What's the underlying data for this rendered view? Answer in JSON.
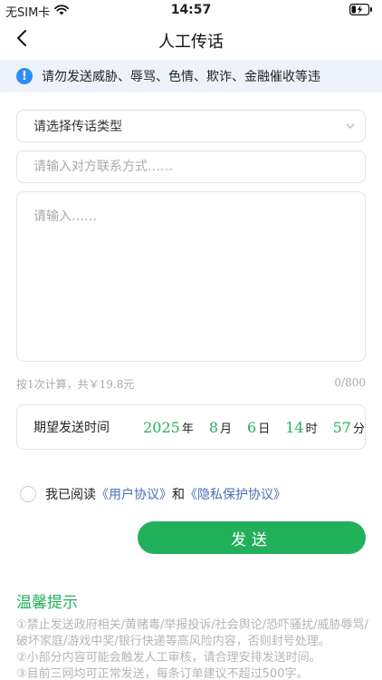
{
  "status_bar": {
    "carrier": "无SIM卡",
    "time": "14:57"
  },
  "nav": {
    "title": "人工传话"
  },
  "notice": {
    "text": "请勿发送威胁、辱骂、色情、欺诈、金融催收等违"
  },
  "form": {
    "type_select_label": "请选择传话类型",
    "contact_placeholder": "请输入对方联系方式……",
    "message_placeholder": "请输入……",
    "pricing": "按1次计算，共￥19.8元",
    "counter": "0/800"
  },
  "send_time": {
    "label": "期望发送时间",
    "year": "2025",
    "year_unit": "年",
    "month": "8",
    "month_unit": "月",
    "day": "6",
    "day_unit": "日",
    "hour": "14",
    "hour_unit": "时",
    "minute": "57",
    "minute_unit": "分"
  },
  "agreement": {
    "prefix": "我已阅读",
    "user_agreement": "《用户协议》",
    "and": "和",
    "privacy_agreement": "《隐私保护协议》"
  },
  "send_button": "发送",
  "tips": {
    "title": "温馨提示",
    "items": [
      "①禁止发送政府相关/黄赌毒/举报投诉/社会舆论/恐吓骚扰/威胁辱骂/破坏家庭/游戏中奖/银行快递等高风险内容，否则封号处理。",
      "②小部分内容可能会触发人工审核，请合理安排发送时间。",
      "③目前三网均可正常发送，每条订单建议不超过500字。"
    ]
  },
  "colors": {
    "accent_green": "#23b05a",
    "link_blue": "#4a6fb5",
    "notice_bg": "#eef3fb",
    "info_icon": "#2f8cf5"
  }
}
